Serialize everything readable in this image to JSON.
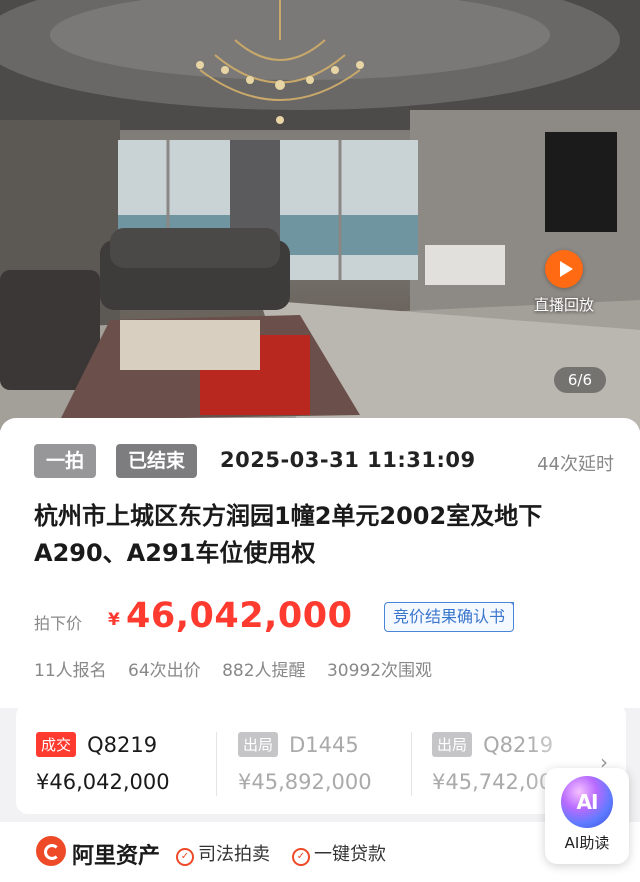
{
  "photo": {
    "live_label": "直播回放",
    "counter": "6/6"
  },
  "auction": {
    "round_tag": "一拍",
    "status_tag": "已结束",
    "end_time": "2025-03-31 11:31:09",
    "extensions": "44次延时",
    "title": "杭州市上城区东方润园1幢2单元2002室及地下A290、A291车位使用权",
    "price_label": "拍下价",
    "price_currency": "¥",
    "price_value": "46,042,000",
    "confirm_label": "竞价结果确认书",
    "stats": [
      "11人报名",
      "64次出价",
      "882人提醒",
      "30992次围观"
    ]
  },
  "bids": [
    {
      "badge": "成交",
      "code": "Q8219",
      "amount": "¥46,042,000"
    },
    {
      "badge": "出局",
      "code": "D1445",
      "amount": "¥45,892,000"
    },
    {
      "badge": "出局",
      "code": "Q8219",
      "amount": "¥45,742,000"
    }
  ],
  "footer": {
    "brand": "阿里资产",
    "features": [
      "司法拍卖",
      "一键贷款"
    ]
  },
  "ai_assist": {
    "icon_text": "AI",
    "label": "AI助读"
  },
  "colors": {
    "accent_red": "#ff3a2f",
    "live_orange": "#ff6a13",
    "link_blue": "#3a76cc",
    "brand_red": "#ee4a28"
  }
}
